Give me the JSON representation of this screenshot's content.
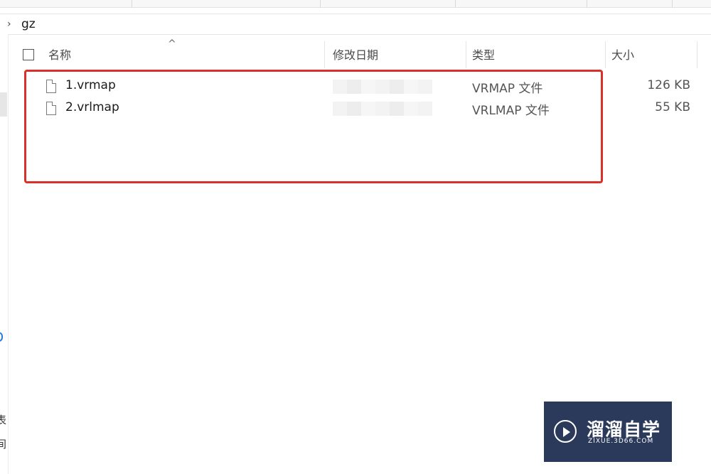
{
  "breadcrumb": {
    "chevron": "›",
    "folder": "gz"
  },
  "columns": {
    "name": "名称",
    "date_modified": "修改日期",
    "type": "类型",
    "size": "大小"
  },
  "files": [
    {
      "name": "1.vrmap",
      "type": "VRMAP 文件",
      "size": "126 KB"
    },
    {
      "name": "2.vrlmap",
      "type": "VRLMAP 文件",
      "size": "55 KB"
    }
  ],
  "nav_fragments": [
    "表",
    "间"
  ],
  "watermark": {
    "title": "溜溜自学",
    "subtitle": "ZIXUE.3D66.COM"
  },
  "colors": {
    "highlight": "#d9302a",
    "watermark_bg": "#2b3a5a",
    "accent": "#2a7bd4"
  },
  "icons": {
    "file": "document-icon",
    "chevron": "chevron-right-icon",
    "sort": "sort-up-icon"
  }
}
